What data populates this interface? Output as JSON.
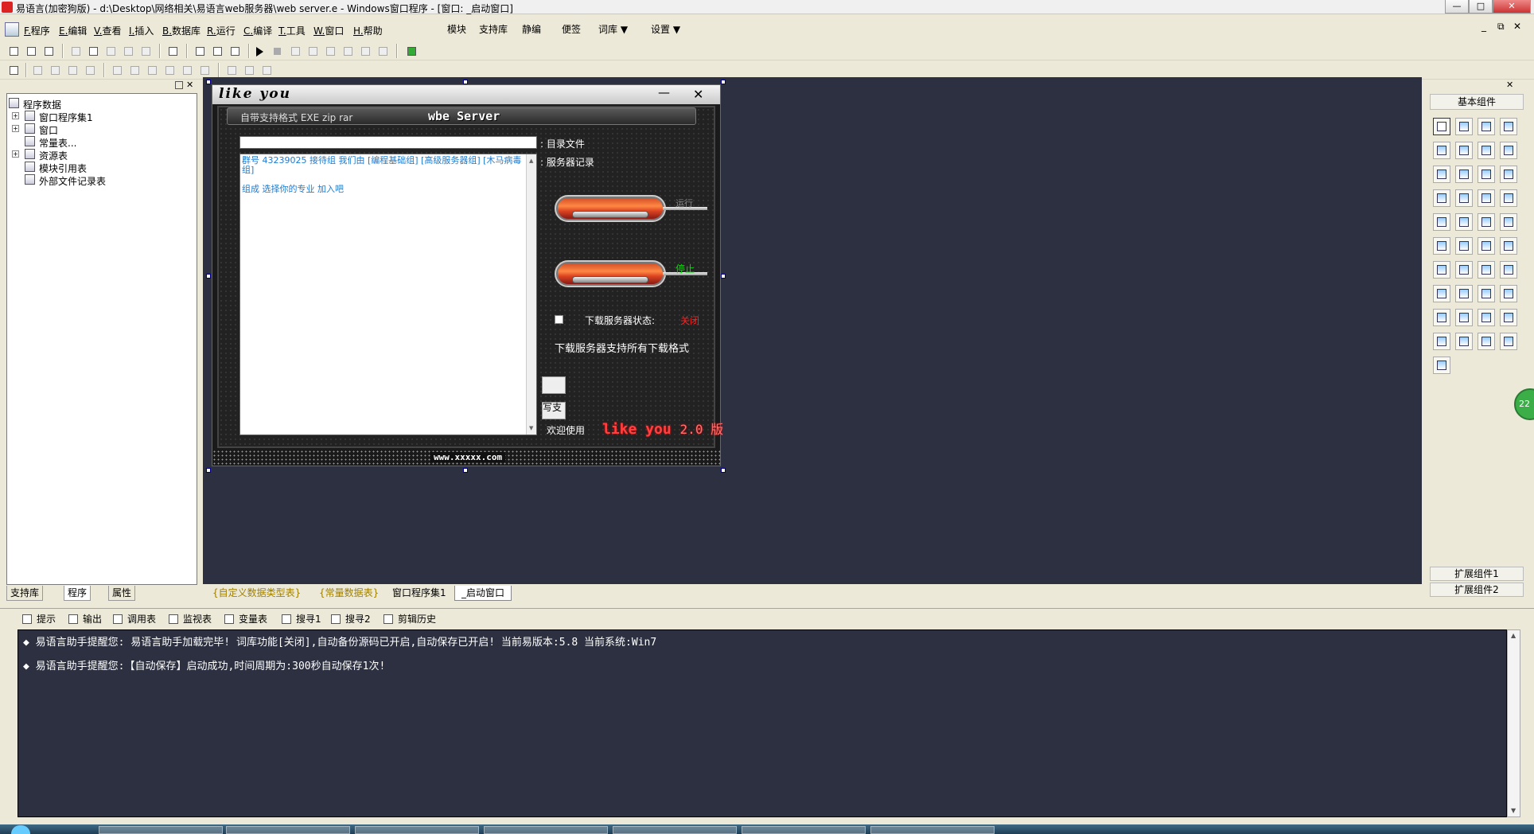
{
  "window": {
    "title": "易语言(加密狗版) - d:\\Desktop\\网络相关\\易语言web服务器\\web server.e - Windows窗口程序 - [窗口: _启动窗口]",
    "min_label": "—",
    "max_label": "□",
    "close_label": "✕"
  },
  "menubar": {
    "items": [
      {
        "key": "F.",
        "label": "程序"
      },
      {
        "key": "E.",
        "label": "编辑"
      },
      {
        "key": "V.",
        "label": "查看"
      },
      {
        "key": "I.",
        "label": "插入"
      },
      {
        "key": "B.",
        "label": "数据库"
      },
      {
        "key": "R.",
        "label": "运行"
      },
      {
        "key": "C.",
        "label": "编译"
      },
      {
        "key": "T.",
        "label": "工具"
      },
      {
        "key": "W.",
        "label": "窗口"
      },
      {
        "key": "H.",
        "label": "帮助"
      }
    ],
    "extras": [
      "模块",
      "支持库",
      "静编",
      "便签",
      "词库 ▼",
      "设置 ▼"
    ],
    "mdi_min": "_",
    "mdi_restore": "⧉",
    "mdi_close": "✕"
  },
  "left_panel": {
    "tree": [
      {
        "label": "程序数据"
      },
      {
        "label": "窗口程序集1"
      },
      {
        "label": "窗口"
      },
      {
        "label": "常量表..."
      },
      {
        "label": "资源表"
      },
      {
        "label": "模块引用表"
      },
      {
        "label": "外部文件记录表"
      }
    ],
    "tabs": [
      "支持库",
      "程序",
      "属性"
    ]
  },
  "editor_tabs": [
    "{自定义数据类型表}",
    "{常量数据表}",
    "窗口程序集1",
    "_启动窗口"
  ],
  "toolbox": {
    "header": "基本组件",
    "ext1": "扩展组件1",
    "ext2": "扩展组件2"
  },
  "badge": "22",
  "form": {
    "title": "like you",
    "min": "—",
    "close": "✕",
    "header_left": "自带支持格式 EXE zip rar",
    "header_right": "wbe Server",
    "dir_label": ": 目录文件",
    "log_label": ": 服务器记录",
    "memo_line1": "群号 43239025 接待组 我们由 [编程基础组] [高级服务器组] [木马病毒组]",
    "memo_line2": "组成 选择你的专业 加入吧",
    "run_label": "运行",
    "stop_label": "停止",
    "status_label": "下载服务器状态:",
    "status_value": "关闭",
    "support_text": "下载服务器支持所有下载格式",
    "mini2_label": "写支",
    "welcome": "欢迎使用",
    "brand": "like you",
    "version": "2.0 版",
    "footer": "www.xxxxx.com"
  },
  "output": {
    "tabs": [
      "提示",
      "输出",
      "调用表",
      "监视表",
      "变量表",
      "搜寻1",
      "搜寻2",
      "剪辑历史"
    ],
    "lines": [
      "◆ 易语言助手提醒您:  易语言助手加载完毕! 词库功能[关闭],自动备份源码已开启,自动保存已开启! 当前易版本:5.8  当前系统:Win7",
      "◆ 易语言助手提醒您:【自动保存】启动成功,时间周期为:300秒自动保存1次!"
    ]
  },
  "colors": {
    "ide_background": "#2c3040",
    "pill_red": "#e84a2a",
    "run_text": "#888888",
    "stop_text": "#00e000",
    "status_off": "#ff2020",
    "memo_text": "#1e7bd0",
    "brand_red": "#ff4040"
  }
}
